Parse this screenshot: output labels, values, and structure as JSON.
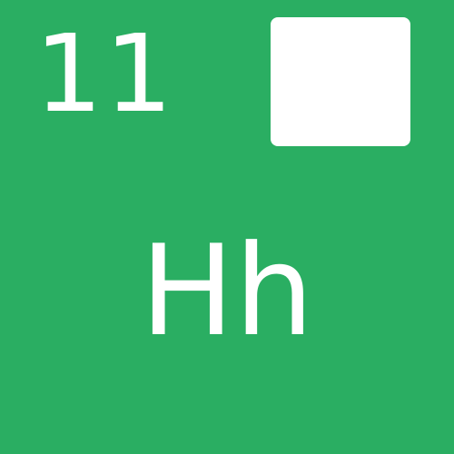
{
  "tile": {
    "number": "11",
    "symbol": "Hh",
    "background_color": "#2aae62",
    "foreground_color": "#ffffff"
  }
}
